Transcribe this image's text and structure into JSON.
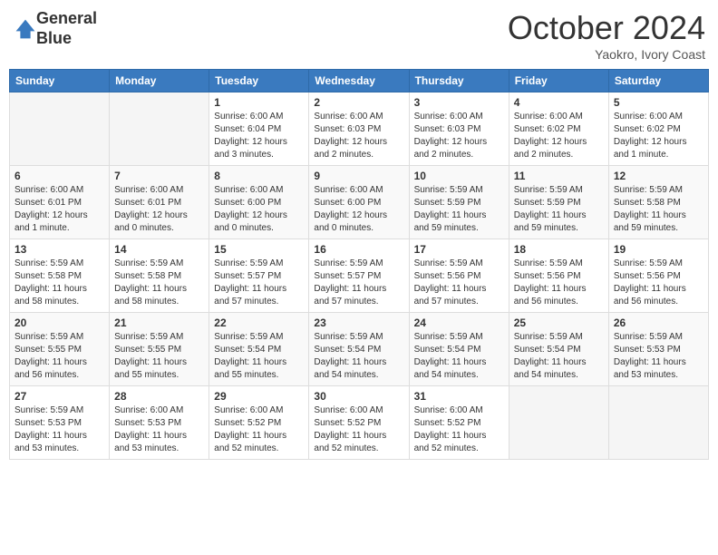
{
  "header": {
    "logo_line1": "General",
    "logo_line2": "Blue",
    "month": "October 2024",
    "location": "Yaokro, Ivory Coast"
  },
  "days_of_week": [
    "Sunday",
    "Monday",
    "Tuesday",
    "Wednesday",
    "Thursday",
    "Friday",
    "Saturday"
  ],
  "weeks": [
    [
      {
        "day": "",
        "empty": true
      },
      {
        "day": "",
        "empty": true
      },
      {
        "day": "1",
        "sunrise": "Sunrise: 6:00 AM",
        "sunset": "Sunset: 6:04 PM",
        "daylight": "Daylight: 12 hours and 3 minutes."
      },
      {
        "day": "2",
        "sunrise": "Sunrise: 6:00 AM",
        "sunset": "Sunset: 6:03 PM",
        "daylight": "Daylight: 12 hours and 2 minutes."
      },
      {
        "day": "3",
        "sunrise": "Sunrise: 6:00 AM",
        "sunset": "Sunset: 6:03 PM",
        "daylight": "Daylight: 12 hours and 2 minutes."
      },
      {
        "day": "4",
        "sunrise": "Sunrise: 6:00 AM",
        "sunset": "Sunset: 6:02 PM",
        "daylight": "Daylight: 12 hours and 2 minutes."
      },
      {
        "day": "5",
        "sunrise": "Sunrise: 6:00 AM",
        "sunset": "Sunset: 6:02 PM",
        "daylight": "Daylight: 12 hours and 1 minute."
      }
    ],
    [
      {
        "day": "6",
        "sunrise": "Sunrise: 6:00 AM",
        "sunset": "Sunset: 6:01 PM",
        "daylight": "Daylight: 12 hours and 1 minute."
      },
      {
        "day": "7",
        "sunrise": "Sunrise: 6:00 AM",
        "sunset": "Sunset: 6:01 PM",
        "daylight": "Daylight: 12 hours and 0 minutes."
      },
      {
        "day": "8",
        "sunrise": "Sunrise: 6:00 AM",
        "sunset": "Sunset: 6:00 PM",
        "daylight": "Daylight: 12 hours and 0 minutes."
      },
      {
        "day": "9",
        "sunrise": "Sunrise: 6:00 AM",
        "sunset": "Sunset: 6:00 PM",
        "daylight": "Daylight: 12 hours and 0 minutes."
      },
      {
        "day": "10",
        "sunrise": "Sunrise: 5:59 AM",
        "sunset": "Sunset: 5:59 PM",
        "daylight": "Daylight: 11 hours and 59 minutes."
      },
      {
        "day": "11",
        "sunrise": "Sunrise: 5:59 AM",
        "sunset": "Sunset: 5:59 PM",
        "daylight": "Daylight: 11 hours and 59 minutes."
      },
      {
        "day": "12",
        "sunrise": "Sunrise: 5:59 AM",
        "sunset": "Sunset: 5:58 PM",
        "daylight": "Daylight: 11 hours and 59 minutes."
      }
    ],
    [
      {
        "day": "13",
        "sunrise": "Sunrise: 5:59 AM",
        "sunset": "Sunset: 5:58 PM",
        "daylight": "Daylight: 11 hours and 58 minutes."
      },
      {
        "day": "14",
        "sunrise": "Sunrise: 5:59 AM",
        "sunset": "Sunset: 5:58 PM",
        "daylight": "Daylight: 11 hours and 58 minutes."
      },
      {
        "day": "15",
        "sunrise": "Sunrise: 5:59 AM",
        "sunset": "Sunset: 5:57 PM",
        "daylight": "Daylight: 11 hours and 57 minutes."
      },
      {
        "day": "16",
        "sunrise": "Sunrise: 5:59 AM",
        "sunset": "Sunset: 5:57 PM",
        "daylight": "Daylight: 11 hours and 57 minutes."
      },
      {
        "day": "17",
        "sunrise": "Sunrise: 5:59 AM",
        "sunset": "Sunset: 5:56 PM",
        "daylight": "Daylight: 11 hours and 57 minutes."
      },
      {
        "day": "18",
        "sunrise": "Sunrise: 5:59 AM",
        "sunset": "Sunset: 5:56 PM",
        "daylight": "Daylight: 11 hours and 56 minutes."
      },
      {
        "day": "19",
        "sunrise": "Sunrise: 5:59 AM",
        "sunset": "Sunset: 5:56 PM",
        "daylight": "Daylight: 11 hours and 56 minutes."
      }
    ],
    [
      {
        "day": "20",
        "sunrise": "Sunrise: 5:59 AM",
        "sunset": "Sunset: 5:55 PM",
        "daylight": "Daylight: 11 hours and 56 minutes."
      },
      {
        "day": "21",
        "sunrise": "Sunrise: 5:59 AM",
        "sunset": "Sunset: 5:55 PM",
        "daylight": "Daylight: 11 hours and 55 minutes."
      },
      {
        "day": "22",
        "sunrise": "Sunrise: 5:59 AM",
        "sunset": "Sunset: 5:54 PM",
        "daylight": "Daylight: 11 hours and 55 minutes."
      },
      {
        "day": "23",
        "sunrise": "Sunrise: 5:59 AM",
        "sunset": "Sunset: 5:54 PM",
        "daylight": "Daylight: 11 hours and 54 minutes."
      },
      {
        "day": "24",
        "sunrise": "Sunrise: 5:59 AM",
        "sunset": "Sunset: 5:54 PM",
        "daylight": "Daylight: 11 hours and 54 minutes."
      },
      {
        "day": "25",
        "sunrise": "Sunrise: 5:59 AM",
        "sunset": "Sunset: 5:54 PM",
        "daylight": "Daylight: 11 hours and 54 minutes."
      },
      {
        "day": "26",
        "sunrise": "Sunrise: 5:59 AM",
        "sunset": "Sunset: 5:53 PM",
        "daylight": "Daylight: 11 hours and 53 minutes."
      }
    ],
    [
      {
        "day": "27",
        "sunrise": "Sunrise: 5:59 AM",
        "sunset": "Sunset: 5:53 PM",
        "daylight": "Daylight: 11 hours and 53 minutes."
      },
      {
        "day": "28",
        "sunrise": "Sunrise: 6:00 AM",
        "sunset": "Sunset: 5:53 PM",
        "daylight": "Daylight: 11 hours and 53 minutes."
      },
      {
        "day": "29",
        "sunrise": "Sunrise: 6:00 AM",
        "sunset": "Sunset: 5:52 PM",
        "daylight": "Daylight: 11 hours and 52 minutes."
      },
      {
        "day": "30",
        "sunrise": "Sunrise: 6:00 AM",
        "sunset": "Sunset: 5:52 PM",
        "daylight": "Daylight: 11 hours and 52 minutes."
      },
      {
        "day": "31",
        "sunrise": "Sunrise: 6:00 AM",
        "sunset": "Sunset: 5:52 PM",
        "daylight": "Daylight: 11 hours and 52 minutes."
      },
      {
        "day": "",
        "empty": true
      },
      {
        "day": "",
        "empty": true
      }
    ]
  ]
}
